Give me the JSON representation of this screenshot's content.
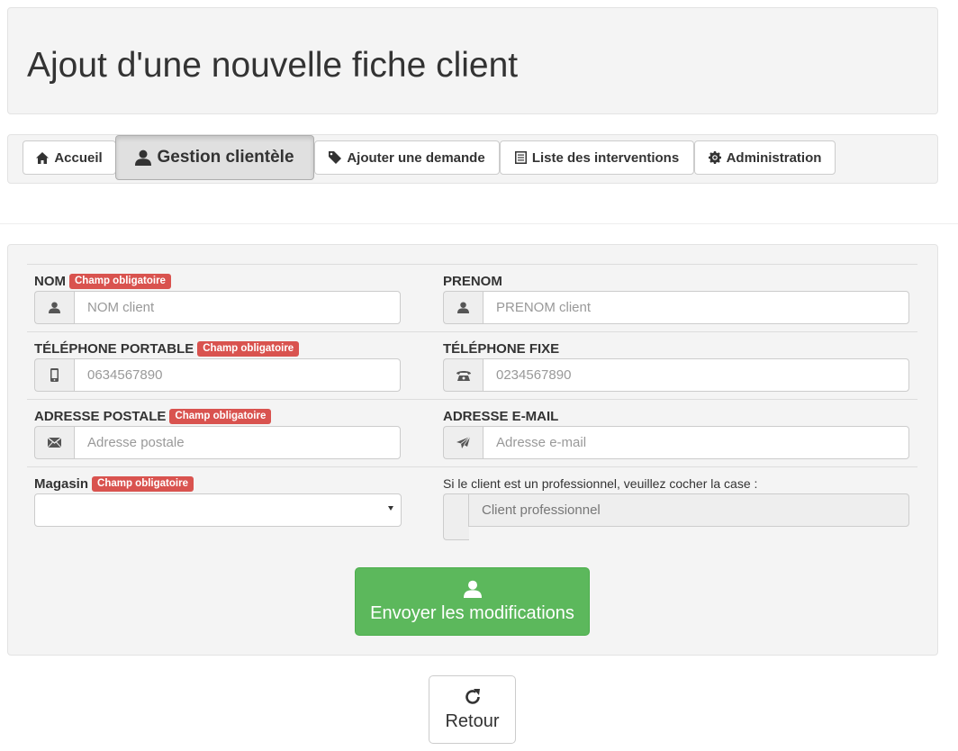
{
  "page": {
    "title": "Ajout d'une nouvelle fiche client"
  },
  "nav": {
    "items": [
      {
        "label": "Accueil",
        "icon": "home-icon"
      },
      {
        "label": "Gestion clientèle",
        "icon": "user-icon",
        "active": true
      },
      {
        "label": "Ajouter une demande",
        "icon": "tag-icon"
      },
      {
        "label": "Liste des interventions",
        "icon": "list-icon"
      },
      {
        "label": "Administration",
        "icon": "gear-icon"
      }
    ]
  },
  "form": {
    "required_badge": "Champ obligatoire",
    "nom": {
      "label": "NOM",
      "placeholder": "NOM client",
      "icon": "user-icon",
      "required": true
    },
    "prenom": {
      "label": "PRENOM",
      "placeholder": "PRENOM client",
      "icon": "user-icon",
      "required": false
    },
    "tel_portable": {
      "label": "TÉLÉPHONE PORTABLE",
      "placeholder": "0634567890",
      "icon": "phone-icon",
      "required": true
    },
    "tel_fixe": {
      "label": "TÉLÉPHONE FIXE",
      "placeholder": "0234567890",
      "icon": "landline-icon",
      "required": false
    },
    "adresse": {
      "label": "ADRESSE POSTALE",
      "placeholder": "Adresse postale",
      "icon": "envelope-icon",
      "required": true
    },
    "email": {
      "label": "ADRESSE E-MAIL",
      "placeholder": "Adresse e-mail",
      "icon": "send-icon",
      "required": false
    },
    "magasin": {
      "label": "Magasin",
      "value": "",
      "required": true
    },
    "professionnel": {
      "label": "Si le client est un professionnel, veuillez cocher la case :",
      "value": "Client professionnel"
    },
    "submit_label": "Envoyer les modifications",
    "back_label": "Retour"
  },
  "colors": {
    "success": "#5cb85c",
    "danger": "#d9534f",
    "well": "#f4f4f4"
  }
}
